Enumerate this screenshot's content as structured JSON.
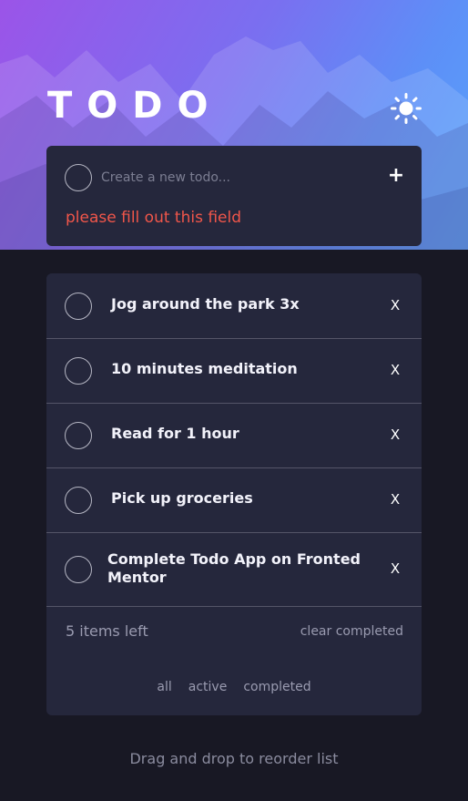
{
  "app": {
    "title": "TODO",
    "theme_toggle_icon": "sun-icon"
  },
  "new_todo": {
    "placeholder": "Create a new todo...",
    "value": "",
    "add_icon": "plus-icon",
    "add_label": "+",
    "error": "please fill out this field"
  },
  "todos": [
    {
      "text": "Jog around the park 3x",
      "completed": false,
      "delete_label": "X"
    },
    {
      "text": "10 minutes meditation",
      "completed": false,
      "delete_label": "X"
    },
    {
      "text": "Read for 1 hour",
      "completed": false,
      "delete_label": "X"
    },
    {
      "text": "Pick up groceries",
      "completed": false,
      "delete_label": "X"
    },
    {
      "text": "Complete Todo App on Fronted Mentor",
      "completed": false,
      "delete_label": "X"
    }
  ],
  "footer": {
    "items_left": "5 items left",
    "clear_completed": "clear completed",
    "filters": [
      "all",
      "active",
      "completed"
    ]
  },
  "hint": "Drag and drop to reorder list",
  "colors": {
    "background": "#181824",
    "card": "#25273c",
    "error": "#f1564a",
    "gradient_start": "#9b54e8",
    "gradient_end": "#58a4fb"
  }
}
